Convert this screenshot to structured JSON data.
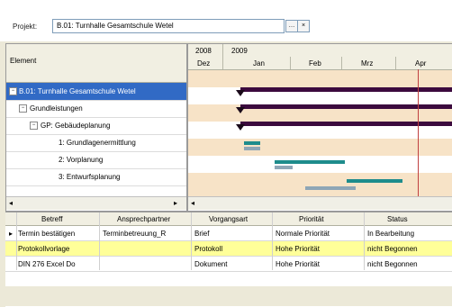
{
  "project": {
    "label": "Projekt:",
    "value": "B.01: Turnhalle Gesamtschule Wetel",
    "btn1_icon": "lookup-icon",
    "btn2_icon": "clear-icon"
  },
  "tree": {
    "header": "Element",
    "rows": [
      {
        "label": "B.01: Turnhalle Gesamtschule Wetel",
        "selected": true,
        "expander": "−"
      },
      {
        "label": "Grundleistungen",
        "selected": false,
        "expander": "−"
      },
      {
        "label": "GP: Gebäudeplanung",
        "selected": false,
        "expander": "−"
      },
      {
        "label": "1: Grundlagenermittlung",
        "selected": false,
        "expander": ""
      },
      {
        "label": "2: Vorplanung",
        "selected": false,
        "expander": ""
      },
      {
        "label": "3: Entwurfsplanung",
        "selected": false,
        "expander": ""
      }
    ],
    "scroll_left": "◂",
    "scroll_right": "▸"
  },
  "gantt": {
    "years": [
      "2008",
      "2009"
    ],
    "months": [
      "Dez",
      "Jan",
      "Feb",
      "Mrz",
      "Apr"
    ],
    "scroll_left": "◂"
  },
  "table": {
    "columns": [
      "Betreff",
      "Ansprechpartner",
      "Vorgangsart",
      "Priorität",
      "Status"
    ],
    "rows": [
      {
        "marker": "▸",
        "cells": [
          "Termin bestätigen",
          "Terminbetreuung_R",
          "Brief",
          "Normale Priorität",
          "In Bearbeitung"
        ],
        "highlight": false
      },
      {
        "marker": "",
        "cells": [
          "Protokollvorlage",
          "",
          "Protokoll",
          "Hohe Priorität",
          "nicht Begonnen"
        ],
        "highlight": true
      },
      {
        "marker": "",
        "cells": [
          "DIN 276 Excel Do",
          "",
          "Dokument",
          "Hohe Priorität",
          "nicht Begonnen"
        ],
        "highlight": false
      }
    ]
  }
}
